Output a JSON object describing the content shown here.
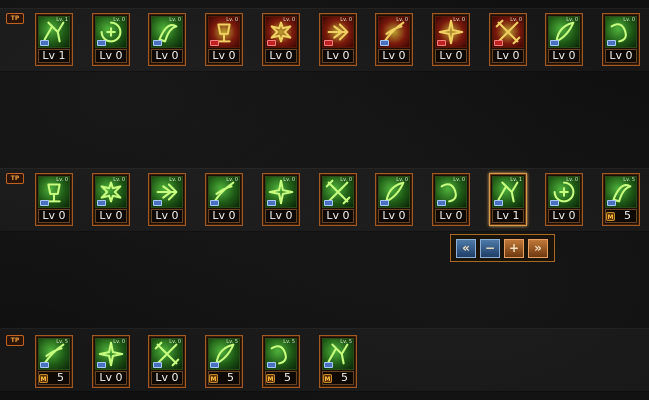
{
  "rows": [
    {
      "tier": "TP",
      "skills": [
        {
          "level_tag": "Lv. 1",
          "label": "Lv 1",
          "icon": "sprinting-figure-icon",
          "style": "green",
          "badge": "S"
        },
        {
          "level_tag": "Lv. 0",
          "label": "Lv 0",
          "icon": "aura-burst-icon",
          "style": "green",
          "badge": "S"
        },
        {
          "level_tag": "Lv. 0",
          "label": "Lv 0",
          "icon": "crescent-blade-icon",
          "style": "green",
          "badge": "S"
        },
        {
          "level_tag": "Lv. 0",
          "label": "Lv 0",
          "icon": "flame-cup-icon",
          "style": "red",
          "badge": "R"
        },
        {
          "level_tag": "Lv. 0",
          "label": "Lv 0",
          "icon": "spiked-sun-icon",
          "style": "red",
          "badge": "R"
        },
        {
          "level_tag": "Lv. 0",
          "label": "Lv 0",
          "icon": "triple-arrow-icon",
          "style": "red",
          "badge": "R"
        },
        {
          "level_tag": "Lv. 0",
          "label": "Lv 0",
          "icon": "slash-wave-icon",
          "style": "red",
          "badge": "S"
        },
        {
          "level_tag": "Lv. 0",
          "label": "Lv 0",
          "icon": "explosion-icon",
          "style": "red",
          "badge": "R"
        },
        {
          "level_tag": "Lv. 0",
          "label": "Lv 0",
          "icon": "crossed-swords-icon",
          "style": "red",
          "badge": "R"
        },
        {
          "level_tag": "Lv. 0",
          "label": "Lv 0",
          "icon": "leaf-blade-icon",
          "style": "green",
          "badge": "S"
        },
        {
          "level_tag": "Lv. 0",
          "label": "Lv 0",
          "icon": "vine-whip-icon",
          "style": "green",
          "badge": "S"
        }
      ]
    },
    {
      "tier": "TP",
      "skills": [
        {
          "level_tag": "Lv. 0",
          "label": "Lv 0",
          "icon": "lunge-figure-icon",
          "style": "green",
          "badge": "S"
        },
        {
          "level_tag": "Lv. 0",
          "label": "Lv 0",
          "icon": "spin-kick-icon",
          "style": "green",
          "badge": "S"
        },
        {
          "level_tag": "Lv. 0",
          "label": "Lv 0",
          "icon": "skull-mask-icon",
          "style": "green",
          "badge": "S"
        },
        {
          "level_tag": "Lv. 0",
          "label": "Lv 0",
          "icon": "whirlwind-icon",
          "style": "green",
          "badge": "S"
        },
        {
          "level_tag": "Lv. 0",
          "label": "Lv 0",
          "icon": "leaping-figure-icon",
          "style": "green",
          "badge": "S"
        },
        {
          "level_tag": "Lv. 0",
          "label": "Lv 0",
          "icon": "diagonal-slash-icon",
          "style": "green",
          "badge": "S"
        },
        {
          "level_tag": "Lv. 0",
          "label": "Lv 0",
          "icon": "hook-strike-icon",
          "style": "green",
          "badge": "S"
        },
        {
          "level_tag": "Lv. 0",
          "label": "Lv 0",
          "icon": "cross-slash-icon",
          "style": "green",
          "badge": "S"
        },
        {
          "level_tag": "Lv. 1",
          "label": "Lv 1",
          "icon": "wind-dash-icon",
          "style": "green",
          "badge": "S",
          "selected": true
        },
        {
          "level_tag": "Lv. 0",
          "label": "Lv 0",
          "icon": "spiked-shield-icon",
          "style": "green",
          "badge": "S"
        },
        {
          "level_tag": "Lv. 5",
          "label": "5",
          "icon": "rising-blade-icon",
          "style": "green",
          "badge": "S",
          "mastery": "M"
        }
      ]
    },
    {
      "tier": "TP",
      "skills": [
        {
          "level_tag": "Lv. 5",
          "label": "5",
          "icon": "swirl-kick-icon",
          "style": "green",
          "badge": "S",
          "mastery": "M"
        },
        {
          "level_tag": "Lv. 0",
          "label": "Lv 0",
          "icon": "uppercut-icon",
          "style": "green",
          "badge": "S"
        },
        {
          "level_tag": "Lv. 0",
          "label": "Lv 0",
          "icon": "shockwave-icon",
          "style": "green",
          "badge": "S"
        },
        {
          "level_tag": "Lv. 5",
          "label": "5",
          "icon": "claw-slash-icon",
          "style": "green",
          "badge": "S",
          "mastery": "M"
        },
        {
          "level_tag": "Lv. 5",
          "label": "5",
          "icon": "dome-shield-icon",
          "style": "green",
          "badge": "S",
          "mastery": "M"
        },
        {
          "level_tag": "Lv. 5",
          "label": "5",
          "icon": "light-pillars-icon",
          "style": "green",
          "badge": "S",
          "mastery": "M"
        }
      ]
    }
  ],
  "level_control": {
    "buttons": [
      {
        "glyph": "«",
        "name": "decrease-max-button",
        "style": "blue"
      },
      {
        "glyph": "−",
        "name": "decrease-button",
        "style": "blue"
      },
      {
        "glyph": "+",
        "name": "increase-button",
        "style": "orange"
      },
      {
        "glyph": "»",
        "name": "increase-max-button",
        "style": "orange"
      }
    ]
  },
  "colors": {
    "slot_border": "#a25a22",
    "green_icon": "#4fb23a",
    "red_icon": "#7a1a0c",
    "label_text": "#f0f0f0"
  }
}
